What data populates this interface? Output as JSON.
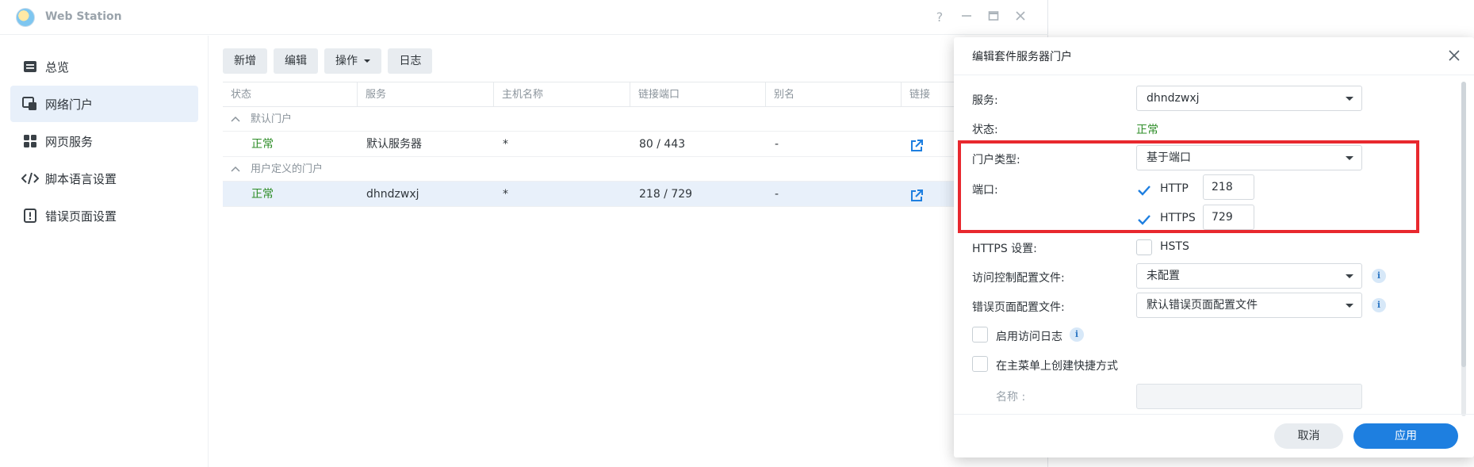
{
  "window": {
    "title": "Web Station",
    "controls": {
      "help": "?",
      "minimize": "—",
      "maximize": "▢",
      "close": "✕"
    }
  },
  "sidebar": {
    "items": [
      {
        "label": "总览",
        "icon": "overview-icon",
        "active": false
      },
      {
        "label": "网络门户",
        "icon": "portal-icon",
        "active": true
      },
      {
        "label": "网页服务",
        "icon": "web-service-icon",
        "active": false
      },
      {
        "label": "脚本语言设置",
        "icon": "code-icon",
        "active": false
      },
      {
        "label": "错误页面设置",
        "icon": "error-page-icon",
        "active": false
      }
    ]
  },
  "toolbar": {
    "add": "新增",
    "edit": "编辑",
    "action": "操作",
    "log": "日志"
  },
  "table": {
    "columns": [
      "状态",
      "服务",
      "主机名称",
      "链接端口",
      "别名",
      "链接"
    ],
    "groups": [
      {
        "label": "默认门户",
        "rows": [
          {
            "status": "正常",
            "service": "默认服务器",
            "host": "*",
            "ports": "80 / 443",
            "alias": "-"
          }
        ]
      },
      {
        "label": "用户定义的门户",
        "rows": [
          {
            "status": "正常",
            "service": "dhndzwxj",
            "host": "*",
            "ports": "218 / 729",
            "alias": "-",
            "selected": true
          }
        ]
      }
    ]
  },
  "dialog": {
    "title": "编辑套件服务器门户",
    "service_label": "服务:",
    "service_value": "dhndzwxj",
    "status_label": "状态:",
    "status_value": "正常",
    "portal_type_label": "门户类型:",
    "portal_type_value": "基于端口",
    "port_label": "端口:",
    "http_label": "HTTP",
    "http_checked": true,
    "http_port": "218",
    "https_label": "HTTPS",
    "https_checked": true,
    "https_port": "729",
    "https_settings_label": "HTTPS 设置:",
    "hsts_label": "HSTS",
    "hsts_checked": false,
    "access_control_label": "访问控制配置文件:",
    "access_control_value": "未配置",
    "error_page_label": "错误页面配置文件:",
    "error_page_value": "默认错误页面配置文件",
    "access_log_label": "启用访问日志",
    "access_log_checked": false,
    "shortcut_label": "在主菜单上创建快捷方式",
    "shortcut_checked": false,
    "name_label": "名称 :",
    "name_value": "",
    "cancel": "取消",
    "apply": "应用",
    "info_glyph": "i"
  },
  "colors": {
    "accent": "#1e7fe0",
    "status_ok": "#2d8d27",
    "highlight": "#e8282e",
    "selected_row": "#e8f0fa"
  }
}
